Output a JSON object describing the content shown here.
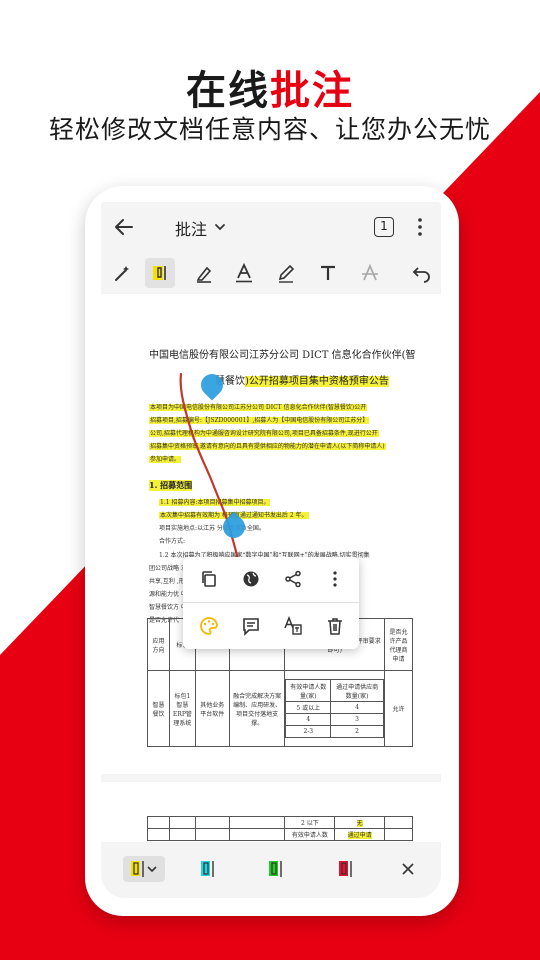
{
  "headline": {
    "prefix": "在线",
    "accent": "批注",
    "subtitle": "轻松修改文档任意内容、让您办公无忧"
  },
  "colors": {
    "accent": "#e60012",
    "highlight": "#f5f03a",
    "handle": "#2a9de0",
    "ink": "#c0392b"
  },
  "toolbar": {
    "title": "批注",
    "page_badge": "1",
    "icons": [
      "back-arrow-icon",
      "chevron-down-icon",
      "page-count-icon",
      "more-vertical-icon"
    ]
  },
  "annotation_tools": [
    "magic-wand-icon",
    "highlighter-icon",
    "pen-icon",
    "underline-icon",
    "pencil-icon",
    "text-icon",
    "strikethrough-icon",
    "undo-icon"
  ],
  "document": {
    "title_line1": "中国电信股份有限公司江苏分公司 DICT 信息化合作伙伴(智",
    "title_line2_a": "慧餐饮",
    "title_line2_b": ")公开招募项目集中资格预审公告",
    "paragraph": [
      "本项目为中国电信股份有限公司江苏分公司 DICT 信息化合作伙伴(智慧餐饮)公开",
      "招募项目,招募编号:【JSZD000001】,招募人为【中国电信股份有限公司江苏分】",
      "公司,招募代理机构为中通服咨询设计研究院有限公司,项目已具备招募条件,现进行公开",
      "招募集中资格预审,邀请有意向的且具有提供相应的物能力的潜在申请人(以下简称申请人)",
      "参加申请。"
    ],
    "section_heading": "1. 招募范围",
    "scope": [
      "1.1 招募内容:本项目招募集中招募项目。",
      "本次集中招募有效期为 格预审通过通知书发出后 2 年。",
      "项目实施地点:以江苏 分业务涉及全国。",
      "合作方式:",
      "1.2 本次招募为了积极响应国家“数字中国”和“互联网+”的发展战略,切实贯彻集",
      "团公司战略 求,结合江苏 方面,资源",
      "共享,互利 ,形成资",
      "源和能力优 中标合作",
      "智慧餐饮方 中标数量。",
      "是否允许代"
    ],
    "table": {
      "headers": [
        "应用方向",
        "标包",
        "品类",
        "",
        "多有非单招申请人数量",
        "是否允许产品代理商申请"
      ],
      "cat_note": "审,其余情况只要满足初步评审要求即可)",
      "rows": [
        [
          "智慧餐饮",
          "标包1 智慧ERP管理系统",
          "其他业务平台软件",
          "融合完成解决方案编制、应用研发、项目交付落地支撑。"
        ]
      ],
      "sub_headers": [
        "有效申请人数量(家)",
        "通过申请供应商数量(家)"
      ],
      "sub_rows": [
        [
          "5 或以上",
          "4"
        ],
        [
          "4",
          "3"
        ],
        [
          "2-3",
          "2"
        ]
      ],
      "last_col": "允许"
    },
    "page2_rows": [
      [
        "2 以下",
        "无"
      ],
      [
        "有效申请人数",
        "通过申请"
      ]
    ]
  },
  "popup": {
    "row1": [
      "copy-icon",
      "globe-icon",
      "share-icon",
      "more-vertical-icon"
    ],
    "row2": [
      "palette-icon",
      "comment-icon",
      "translate-icon",
      "delete-icon"
    ]
  },
  "highlight_colors": [
    {
      "name": "yellow",
      "hex": "#f5e000"
    },
    {
      "name": "cyan",
      "hex": "#22d3e0"
    },
    {
      "name": "green",
      "hex": "#22cc22"
    },
    {
      "name": "red",
      "hex": "#e6112b"
    }
  ]
}
